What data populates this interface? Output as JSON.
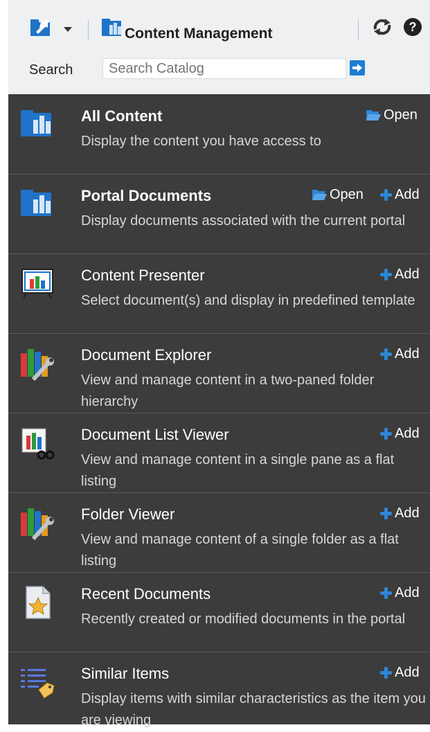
{
  "toolbar": {
    "title": "Content Management"
  },
  "search": {
    "label": "Search",
    "placeholder": "Search Catalog"
  },
  "items": [
    {
      "name": "All Content",
      "desc": "Display the content you have access to",
      "open": "Open"
    },
    {
      "name": "Portal Documents",
      "desc": "Display documents associated with the current portal",
      "open": "Open",
      "add": "Add"
    },
    {
      "name": "Content Presenter",
      "desc": "Select document(s) and display in predefined template",
      "add": "Add"
    },
    {
      "name": "Document Explorer",
      "desc": "View and manage content in a two-paned folder hierarchy",
      "add": "Add"
    },
    {
      "name": "Document List Viewer",
      "desc": "View and manage content in a single pane as a flat listing",
      "add": "Add"
    },
    {
      "name": "Folder Viewer",
      "desc": "View and manage content of a single folder as a flat listing",
      "add": "Add"
    },
    {
      "name": "Recent Documents",
      "desc": "Recently created or modified documents in the portal",
      "add": "Add"
    },
    {
      "name": "Similar Items",
      "desc": "Display items with similar characteristics as the item you are viewing",
      "add": "Add"
    }
  ]
}
